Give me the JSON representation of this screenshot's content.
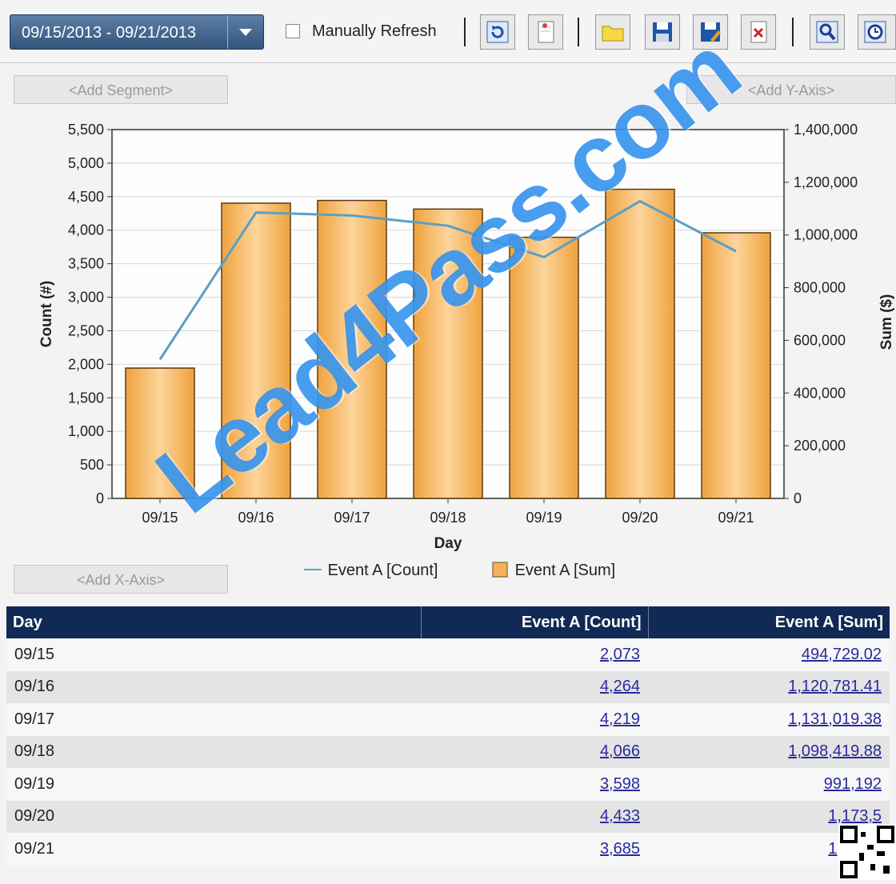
{
  "toolbar": {
    "date_range": "09/15/2013 - 09/21/2013",
    "manual_refresh_label": "Manually Refresh",
    "buttons": [
      "refresh-icon",
      "new-report-icon",
      "open-folder-icon",
      "save-icon",
      "save-as-icon",
      "delete-icon",
      "search-icon",
      "schedule-icon"
    ]
  },
  "segment": {
    "add_segment": "<Add Segment>",
    "add_y_axis": "<Add Y-Axis>",
    "add_x_axis": "<Add X-Axis>"
  },
  "chart_data": {
    "type": "bar",
    "categories": [
      "09/15",
      "09/16",
      "09/17",
      "09/18",
      "09/19",
      "09/20",
      "09/21"
    ],
    "series": [
      {
        "name": "Event A [Sum]",
        "type": "bar",
        "axis": "right",
        "values": [
          494729.02,
          1120781.41,
          1131019.38,
          1098419.88,
          991192,
          1173500,
          1008300
        ],
        "color": "#f5b25a"
      },
      {
        "name": "Event A [Count]",
        "type": "line",
        "axis": "left",
        "values": [
          2073,
          4264,
          4219,
          4066,
          3598,
          4433,
          3685
        ],
        "color": "#5b9fc4"
      }
    ],
    "xlabel": "Day",
    "ylabel": "Count (#)",
    "y2label": "Sum ($)",
    "ylim": [
      0,
      5500
    ],
    "y2lim": [
      0,
      1400000
    ],
    "yticks": [
      "0",
      "500",
      "1,000",
      "1,500",
      "2,000",
      "2,500",
      "3,000",
      "3,500",
      "4,000",
      "4,500",
      "5,000",
      "5,500"
    ],
    "y2ticks": [
      "0",
      "200,000",
      "400,000",
      "600,000",
      "800,000",
      "1,000,000",
      "1,200,000",
      "1,400,000"
    ],
    "grid": true
  },
  "legend": {
    "count": "Event A [Count]",
    "sum": "Event A [Sum]"
  },
  "table": {
    "headers": [
      "Day",
      "Event A [Count]",
      "Event A [Sum]"
    ],
    "rows": [
      [
        "09/15",
        "2,073",
        "494,729.02"
      ],
      [
        "09/16",
        "4,264",
        "1,120,781.41"
      ],
      [
        "09/17",
        "4,219",
        "1,131,019.38"
      ],
      [
        "09/18",
        "4,066",
        "1,098,419.88"
      ],
      [
        "09/19",
        "3,598",
        "991,192"
      ],
      [
        "09/20",
        "4,433",
        "1,173,5"
      ],
      [
        "09/21",
        "3,685",
        "1,008,3"
      ]
    ]
  },
  "watermark": "Lead4Pass.com"
}
